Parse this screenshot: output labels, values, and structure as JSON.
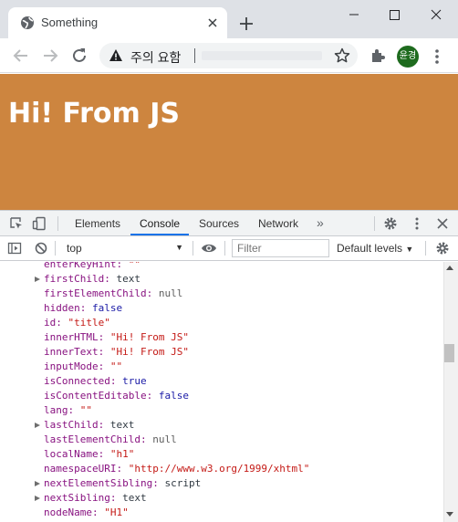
{
  "browser": {
    "tab_title": "Something",
    "omnibox_warning_text": "주의 요함",
    "profile_initials": "윤경"
  },
  "page": {
    "heading": "Hi! From JS",
    "background_color": "#cd853f"
  },
  "devtools": {
    "tabs": [
      {
        "label": "Elements",
        "active": false
      },
      {
        "label": "Console",
        "active": true
      },
      {
        "label": "Sources",
        "active": false
      },
      {
        "label": "Network",
        "active": false
      }
    ],
    "more_tabs_glyph": "»",
    "context": "top",
    "filter_placeholder": "Filter",
    "levels_label": "Default levels"
  },
  "console": {
    "entries": [
      {
        "key": "enterKeyHint",
        "value": "\"\"",
        "type": "str",
        "expandable": false,
        "partial": true
      },
      {
        "key": "firstChild",
        "value": "text",
        "type": "obj",
        "expandable": true
      },
      {
        "key": "firstElementChild",
        "value": "null",
        "type": "null",
        "expandable": false
      },
      {
        "key": "hidden",
        "value": "false",
        "type": "bool",
        "expandable": false
      },
      {
        "key": "id",
        "value": "\"title\"",
        "type": "str",
        "expandable": false
      },
      {
        "key": "innerHTML",
        "value": "\"Hi! From JS\"",
        "type": "str",
        "expandable": false
      },
      {
        "key": "innerText",
        "value": "\"Hi! From JS\"",
        "type": "str",
        "expandable": false
      },
      {
        "key": "inputMode",
        "value": "\"\"",
        "type": "str",
        "expandable": false
      },
      {
        "key": "isConnected",
        "value": "true",
        "type": "bool",
        "expandable": false
      },
      {
        "key": "isContentEditable",
        "value": "false",
        "type": "bool",
        "expandable": false
      },
      {
        "key": "lang",
        "value": "\"\"",
        "type": "str",
        "expandable": false
      },
      {
        "key": "lastChild",
        "value": "text",
        "type": "obj",
        "expandable": true
      },
      {
        "key": "lastElementChild",
        "value": "null",
        "type": "null",
        "expandable": false
      },
      {
        "key": "localName",
        "value": "\"h1\"",
        "type": "str",
        "expandable": false
      },
      {
        "key": "namespaceURI",
        "value": "\"http://www.w3.org/1999/xhtml\"",
        "type": "str",
        "expandable": false
      },
      {
        "key": "nextElementSibling",
        "value": "script",
        "type": "obj",
        "expandable": true
      },
      {
        "key": "nextSibling",
        "value": "text",
        "type": "obj",
        "expandable": true
      },
      {
        "key": "nodeName",
        "value": "\"H1\"",
        "type": "str",
        "expandable": false
      }
    ]
  }
}
